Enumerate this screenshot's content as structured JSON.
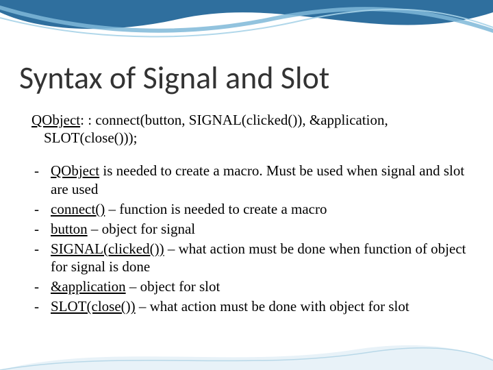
{
  "title": "Syntax of Signal and Slot",
  "code": {
    "line1_a": "QObject",
    "line1_b": ": : connect(button, SIGNAL(clicked()), &application,",
    "line2": "SLOT(close()));"
  },
  "bullets": [
    {
      "u": "QObject",
      "rest": " is needed to create a macro. Must be used when signal and slot are used"
    },
    {
      "u": "connect()",
      "rest": " – function is needed to create a macro"
    },
    {
      "u": "button",
      "rest": " – object for signal"
    },
    {
      "u": "SIGNAL(clicked())",
      "rest": " – what action must be done when function of object for signal is done"
    },
    {
      "u": "&application",
      "rest": " – object for slot"
    },
    {
      "u": "SLOT(close())",
      "rest": " – what action must be done with object for slot"
    }
  ]
}
